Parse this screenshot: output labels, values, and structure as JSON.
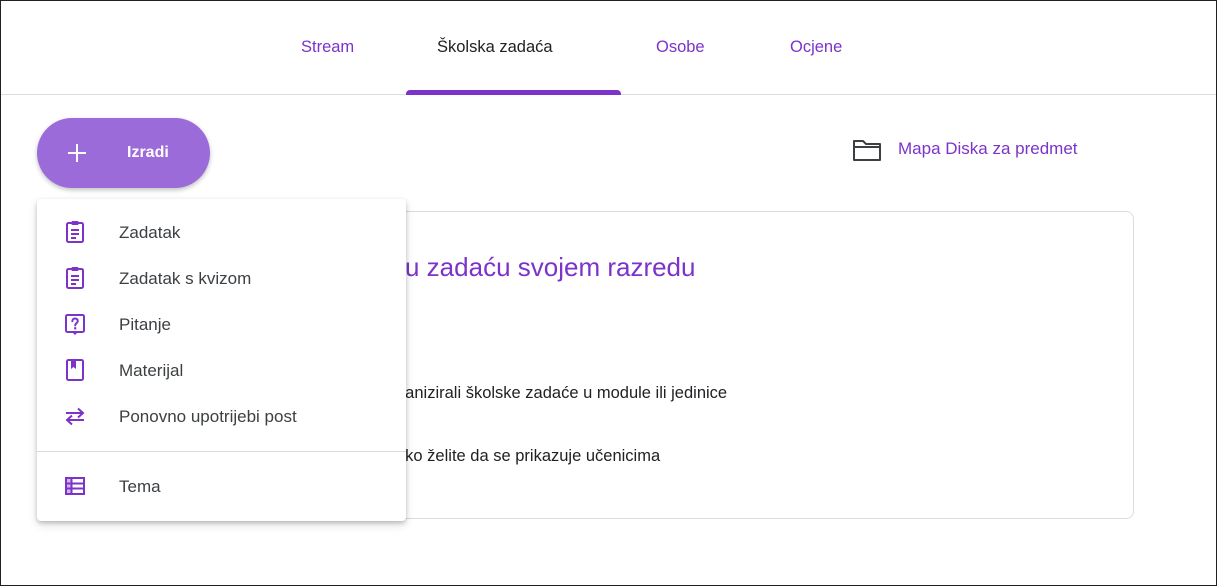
{
  "tabs": [
    {
      "label": "Stream"
    },
    {
      "label": "Školska zadaća"
    },
    {
      "label": "Osobe"
    },
    {
      "label": "Ocjene"
    }
  ],
  "active_tab": "Školska zadaća",
  "create_button": {
    "label": "Izradi",
    "icon": "plus-icon"
  },
  "drive_folder": {
    "label": "Mapa Diska za predmet",
    "icon": "folder-icon"
  },
  "card": {
    "title_partial": "u zadaću svojem razredu",
    "line1_partial": "ganizirali školske zadaće u module ili jedinice",
    "line2_partial": "ako želite da se prikazuje učenicima"
  },
  "menu": {
    "items": [
      {
        "label": "Zadatak",
        "icon": "assignment-icon"
      },
      {
        "label": "Zadatak s kvizom",
        "icon": "quiz-assignment-icon"
      },
      {
        "label": "Pitanje",
        "icon": "question-icon"
      },
      {
        "label": "Materijal",
        "icon": "material-icon"
      },
      {
        "label": "Ponovno upotrijebi post",
        "icon": "repeat-icon"
      },
      {
        "label": "Tema",
        "icon": "topic-list-icon"
      }
    ]
  },
  "colors": {
    "accent": "#7b33c9",
    "create_button_bg": "#9b6bd9",
    "divider": "#dadce0",
    "active_tab_text": "#202124"
  }
}
